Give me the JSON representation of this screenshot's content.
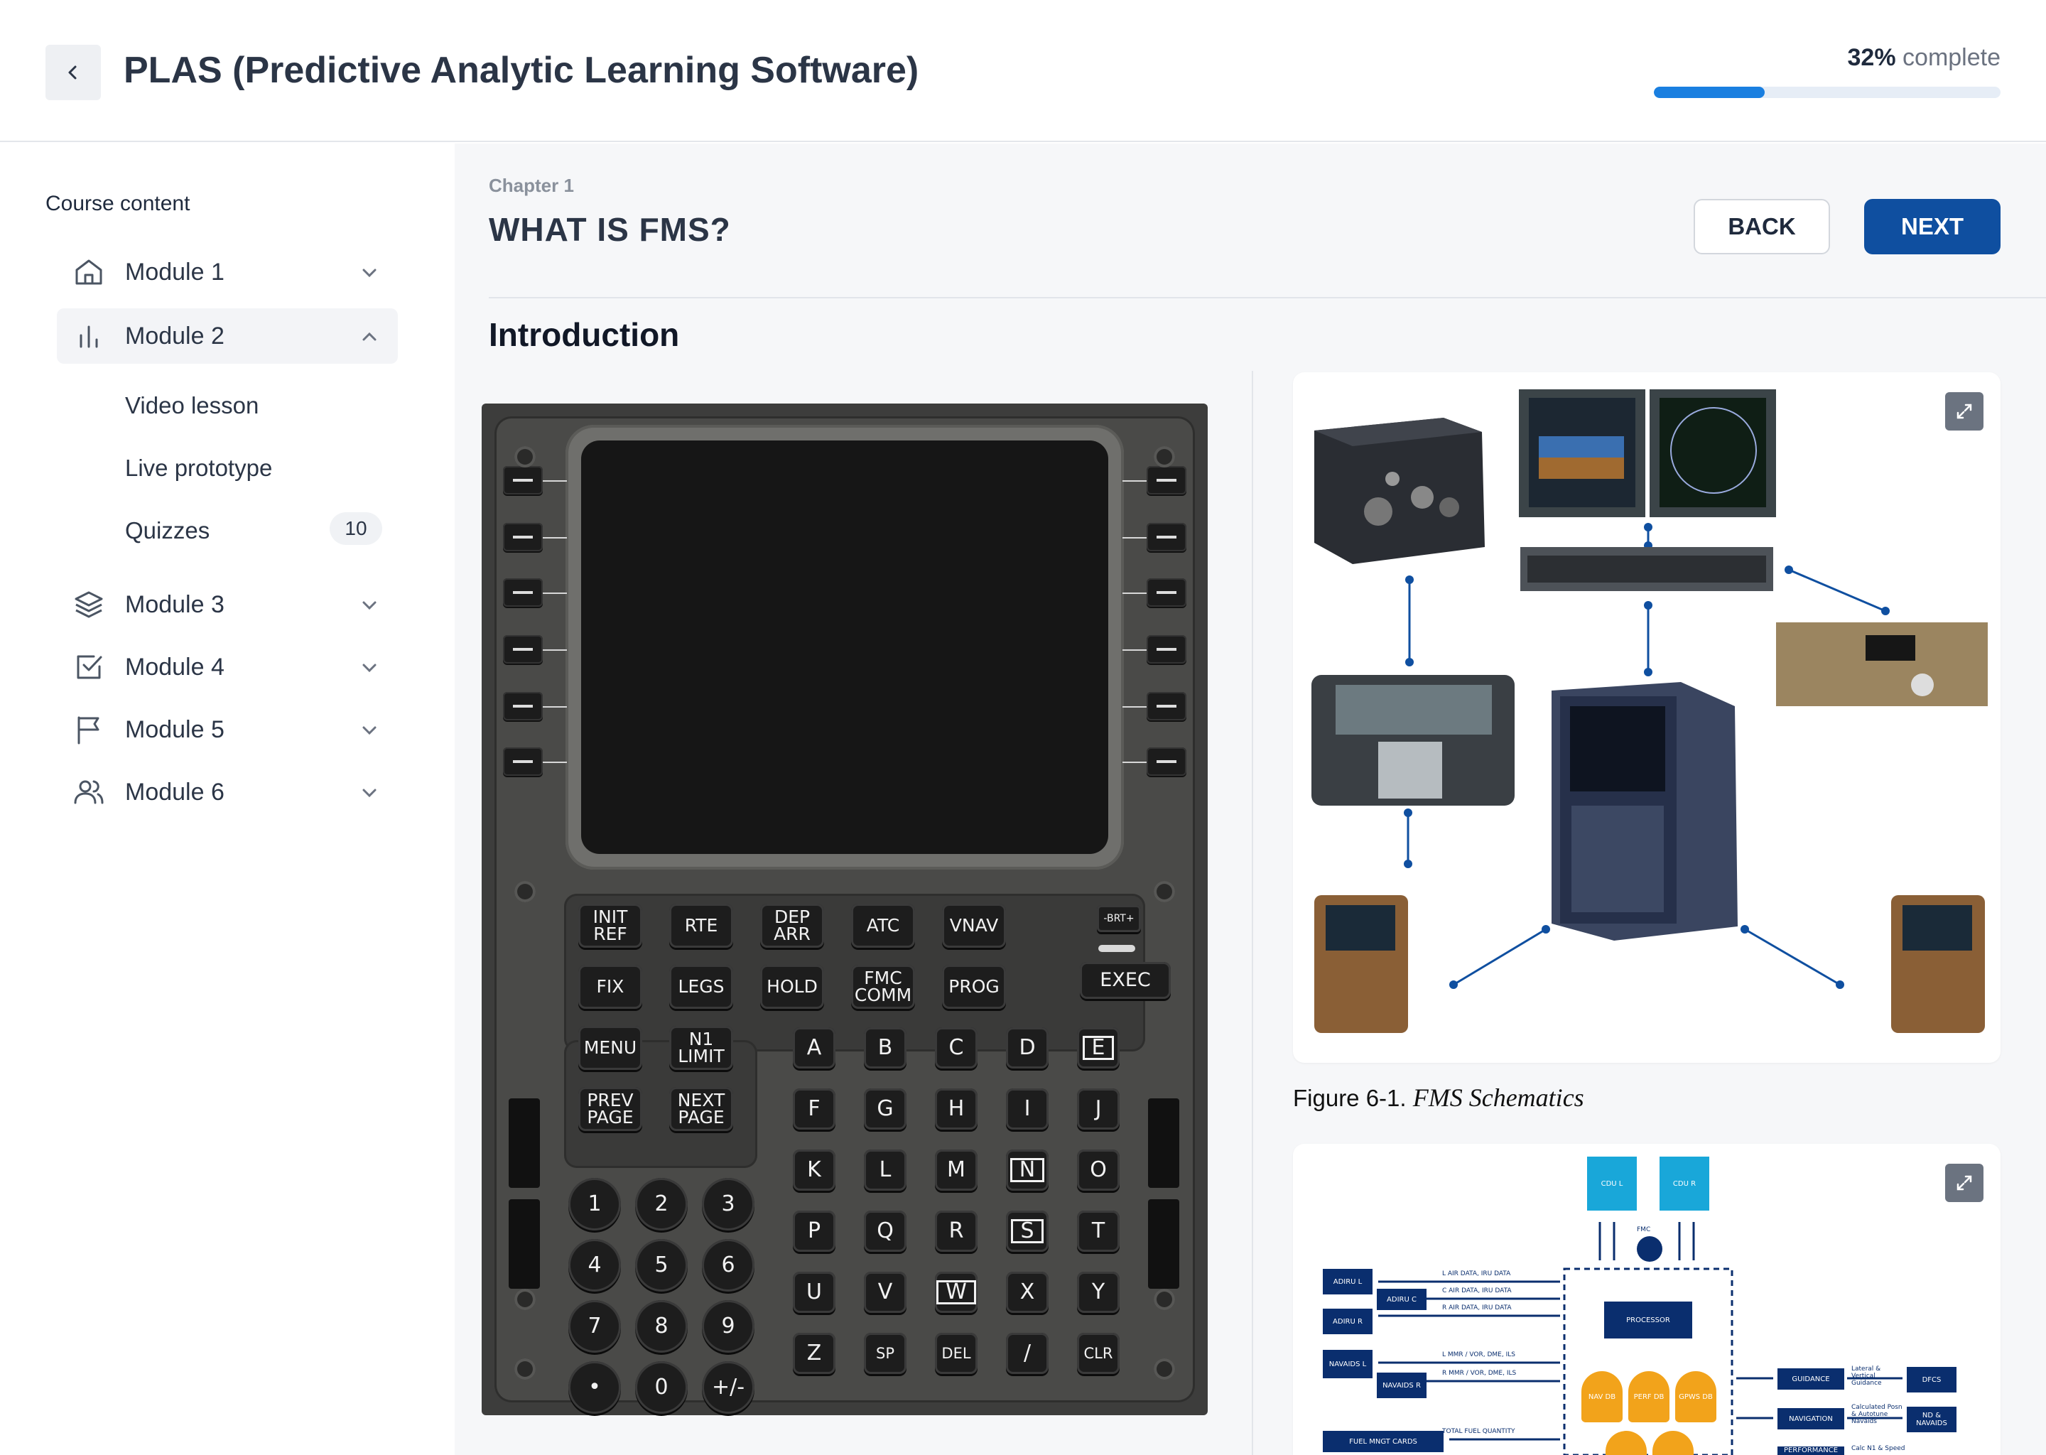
{
  "header": {
    "app_title": "PLAS (Predictive Analytic Learning Software)",
    "progress_percent_text": "32%",
    "progress_suffix": "complete",
    "progress_value": 0.32
  },
  "sidebar": {
    "heading": "Course content",
    "modules": [
      {
        "label": "Module 1",
        "icon": "home-icon",
        "expanded": false
      },
      {
        "label": "Module 2",
        "icon": "bar-chart-icon",
        "expanded": true
      },
      {
        "label": "Module 3",
        "icon": "layers-icon",
        "expanded": false
      },
      {
        "label": "Module 4",
        "icon": "check-square-icon",
        "expanded": false
      },
      {
        "label": "Module 5",
        "icon": "flag-icon",
        "expanded": false
      },
      {
        "label": "Module 6",
        "icon": "users-icon",
        "expanded": false
      }
    ],
    "module2_items": [
      {
        "label": "Video lesson"
      },
      {
        "label": "Live prototype"
      },
      {
        "label": "Quizzes",
        "badge": "10"
      }
    ]
  },
  "main": {
    "chapter": "Chapter 1",
    "title": "WHAT IS FMS?",
    "back_label": "BACK",
    "next_label": "NEXT",
    "section_title": "Introduction"
  },
  "cdu": {
    "function_keys_row1": [
      "INIT\nREF",
      "RTE",
      "DEP\nARR",
      "ATC",
      "VNAV"
    ],
    "function_keys_row2": [
      "FIX",
      "LEGS",
      "HOLD",
      "FMC\nCOMM",
      "PROG"
    ],
    "function_keys_row3": [
      "MENU",
      "N1\nLIMIT"
    ],
    "function_keys_row4": [
      "PREV\nPAGE",
      "NEXT\nPAGE"
    ],
    "brt_label": "-BRT+",
    "exec_label": "EXEC",
    "numeric_keys": [
      "1",
      "2",
      "3",
      "4",
      "5",
      "6",
      "7",
      "8",
      "9",
      "•",
      "0",
      "+/-"
    ],
    "alpha_keys": [
      "A",
      "B",
      "C",
      "D",
      "E",
      "F",
      "G",
      "H",
      "I",
      "J",
      "K",
      "L",
      "M",
      "N",
      "O",
      "P",
      "Q",
      "R",
      "S",
      "T",
      "U",
      "V",
      "W",
      "X",
      "Y",
      "Z",
      "SP",
      "DEL",
      "/",
      "CLR"
    ],
    "boxed_keys": [
      "E",
      "N",
      "S",
      "W"
    ]
  },
  "figures": {
    "caption_prefix": "Figure 6-1.",
    "caption_title": "FMS Schematics",
    "diagram": {
      "cdu_l": "CDU L",
      "cdu_r": "CDU R",
      "fmc": "FMC",
      "processor": "PROCESSOR",
      "adiru_l": "ADIRU L",
      "adiru_c": "ADIRU C",
      "adiru_r": "ADIRU R",
      "navaids_l": "NAVAIDS L",
      "navaids_r": "NAVAIDS R",
      "fuel": "FUEL MNGT CARDS",
      "l_air": "L AIR DATA, IRU DATA",
      "c_air": "C AIR DATA, IRU DATA",
      "r_air": "R AIR DATA, IRU DATA",
      "l_mmr": "L MMR / VOR, DME, ILS",
      "r_mmr": "R MMR / VOR, DME, ILS",
      "total_fuel": "TOTAL FUEL QUANTITY",
      "nav_db": "NAV DB",
      "perf_db": "PERF DB",
      "gpws_db": "GPWS DB",
      "guidance": "GUIDANCE",
      "navigation": "NAVIGATION",
      "performance": "PERFORMANCE",
      "lat_vert": "Lateral & Vertical Guidance",
      "calc_posn": "Calculated Posn & Autotune Navaids",
      "calc_n1": "Calc N1 & Speed",
      "dfcs": "DFCS",
      "nd_navaids": "ND & NAVAIDS"
    }
  },
  "colors": {
    "accent": "#0f4fa0",
    "progress": "#1a7fe0",
    "diagram_blue": "#0a2e6e",
    "diagram_cyan": "#19a7d9",
    "diagram_orange": "#f2a31b"
  }
}
